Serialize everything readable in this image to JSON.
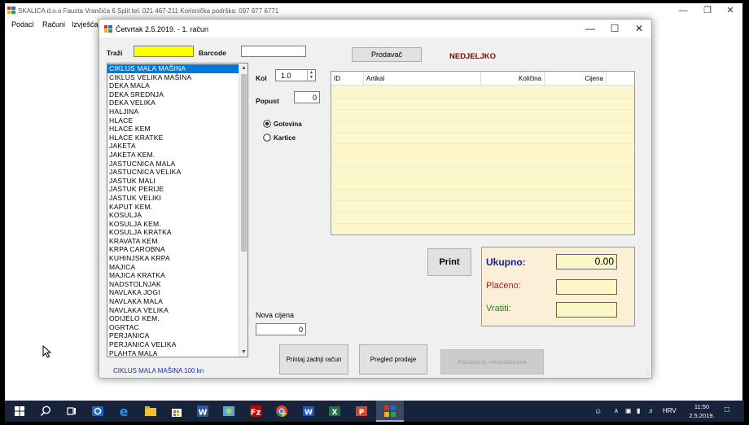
{
  "main_window": {
    "title": "SKALICA d.o.o Fausta Vrančića 6 Split  tel: 021 467-211  Korisnička podrška: 097 677 6771",
    "menu": [
      "Podaci",
      "Računi",
      "Izvješća"
    ]
  },
  "dialog": {
    "title": "Četvrtak 2.5.2019.  -  1. račun",
    "search": {
      "label": "Traži",
      "value": ""
    },
    "barcode": {
      "label": "Barcode",
      "value": ""
    },
    "seller_button": "Prodavač",
    "seller_name": "NEDJELJKO",
    "kol": {
      "label": "Kol",
      "value": "1.0"
    },
    "popust": {
      "label": "Popust",
      "value": "0"
    },
    "payment": [
      {
        "label": "Gotovina",
        "selected": true
      },
      {
        "label": "Kartice",
        "selected": false
      }
    ],
    "products": [
      "CIKLUS MALA MAŠINA",
      "CIKLUS VELIKA MAŠINA",
      "DEKA MALA",
      "DEKA SREDNJA",
      "DEKA VELIKA",
      "HALJINA",
      "HLACE",
      "HLACE KEM",
      "HLACE KRATKE",
      "JAKETA",
      "JAKETA KEM.",
      "JASTUCNICA MALA",
      "JASTUCNICA VELIKA",
      "JASTUK MALI",
      "JASTUK PERIJE",
      "JASTUK VELIKI",
      "KAPUT KEM.",
      "KOSULJA",
      "KOSULJA KEM.",
      "KOSULJA KRATKA",
      "KRAVATA KEM.",
      "KRPA CAROBNA",
      "KUHINJSKA KRPA",
      "MAJICA",
      "MAJICA KRATKA",
      "NADSTOLNJAK",
      "NAVLAKA JOGI",
      "NAVLAKA MALA",
      "NAVLAKA VELIKA",
      "ODIJELO KEM.",
      "OGRTAC",
      "PERJANICA",
      "PERJANICA VELIKA",
      "PLAHTA MALA"
    ],
    "selected_product_index": 0,
    "grid_headers": [
      "ID",
      "Artikal",
      "Količina",
      "Cijena"
    ],
    "print_button": "Print",
    "totals": {
      "ukupno_label": "Ukupno:",
      "ukupno_value": "0.00",
      "placeno_label": "Plaćeno:",
      "placeno_value": "",
      "vratiti_label": "Vratiti:",
      "vratiti_value": ""
    },
    "nova_cijena": {
      "label": "Nova cijena",
      "value": "0"
    },
    "buttons": {
      "printaj_zadnji": "Printaj zadnji račun",
      "pregled_prodaje": "Pregled prodaje",
      "fiskaliziraj": "Fiskaliziraj nefiskalizirane"
    },
    "status": "CIKLUS MALA MAŠINA   100 kn"
  },
  "taskbar": {
    "icons": [
      "windows-start-icon",
      "search-icon",
      "task-view-icon",
      "outlook-icon",
      "edge-icon",
      "file-explorer-icon",
      "store-icon",
      "word-icon",
      "photos-icon",
      "filezilla-icon",
      "chrome-icon",
      "word-doc-icon",
      "excel-icon",
      "powerpoint-icon",
      "skalica-app-icon"
    ],
    "language": "HRV",
    "time": "11:50",
    "date": "2.5.2019."
  },
  "colors": {
    "selection": "#0078d7",
    "search_field": "#ffff00",
    "seller_name": "#8b0000",
    "ukupno": "#0d1fa6",
    "placeno": "#c8110e",
    "vratiti": "#1f8a13",
    "grid_bg": "#fcf6cf",
    "totals_bg": "#fcefd7"
  }
}
